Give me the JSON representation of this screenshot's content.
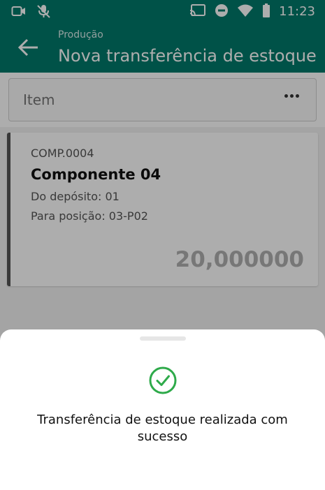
{
  "status_bar": {
    "time": "11:23",
    "left_icons": [
      "video-camera-icon",
      "microphone-off-icon"
    ],
    "right_icons": [
      "cast-icon",
      "do-not-disturb-icon",
      "wifi-icon",
      "battery-icon"
    ]
  },
  "app_bar": {
    "back_icon": "arrow-left-icon",
    "subtitle": "Produção",
    "title": "Nova transferência de estoque"
  },
  "search": {
    "placeholder": "Item",
    "more_icon": "more-horizontal-icon"
  },
  "list": {
    "items": [
      {
        "code": "COMP.0004",
        "name": "Componente 04",
        "from_deposit": "Do depósito: 01",
        "to_position": "Para posição: 03-P02",
        "quantity": "20,000000"
      }
    ]
  },
  "bottom_sheet": {
    "icon": "check-circle-icon",
    "message": "Transferência de estoque realizada com sucesso"
  },
  "colors": {
    "primary": "#00796b",
    "success": "#2eaa4a"
  }
}
